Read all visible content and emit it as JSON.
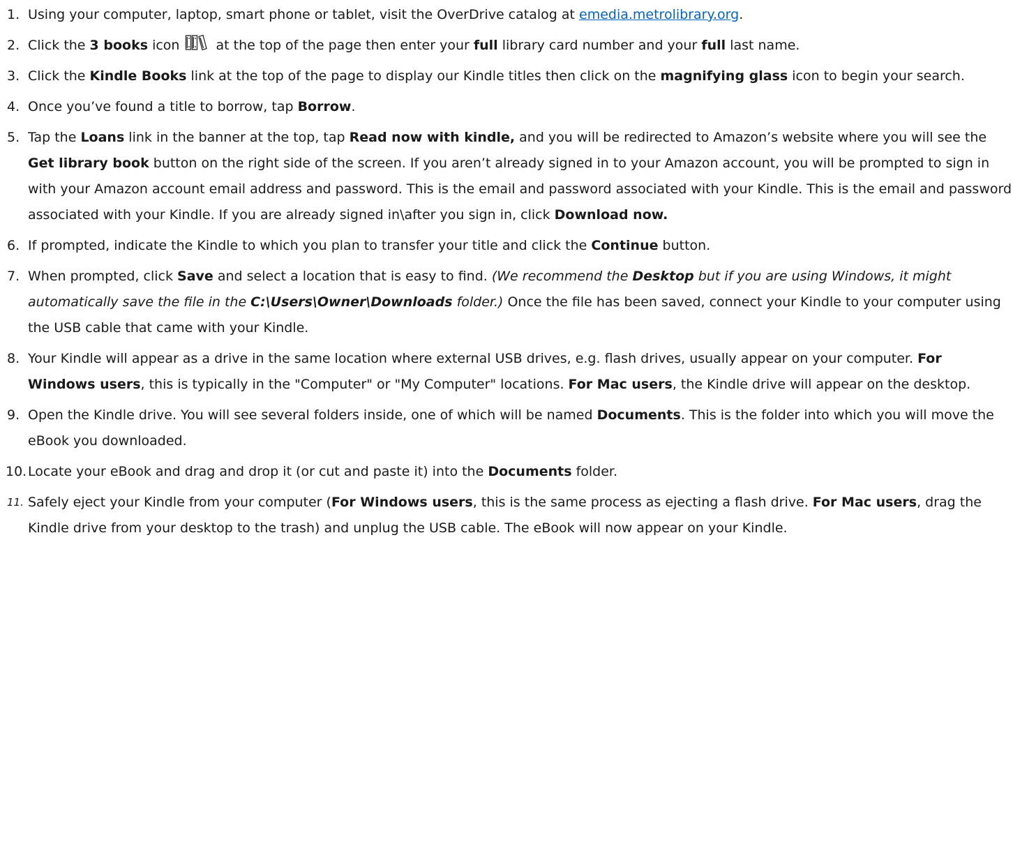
{
  "steps": [
    {
      "number": "1.",
      "p1": "Using your computer, laptop, smart phone or tablet, visit the OverDrive catalog at ",
      "link": "emedia.metrolibrary.org",
      "p2": "."
    },
    {
      "number": "2.",
      "p1": "Click the ",
      "b1": "3 books",
      "p2": " icon",
      "icon": "three-books-icon",
      "p3": " at the top of the page then enter your ",
      "b2": "full",
      "p4": " library card number and your ",
      "b3": "full",
      "p5": " last name."
    },
    {
      "number": "3.",
      "p1": "Click the ",
      "b1": "Kindle Books",
      "p2": " link at the top of the page to display our Kindle titles then click on the ",
      "b2": "magnifying glass",
      "p3": " icon to begin your search."
    },
    {
      "number": "4.",
      "p1": "Once you’ve found a title to borrow, tap ",
      "b1": "Borrow",
      "p2": "."
    },
    {
      "number": "5.",
      "p1": "Tap the ",
      "b1": "Loans",
      "p2": " link in the banner at the top, tap ",
      "b2": "Read now with kindle,",
      "p3": " and you will be redirected to Amazon’s website where you will see the ",
      "b3": "Get library book",
      "p4": " button on the right side of the screen. If you aren’t already signed in to your Amazon account, you will be prompted to sign in with your Amazon account email address and password. This is the email and password associated with your Kindle. This is the email and password associated with your Kindle. If you are already signed in\\after you sign in, click ",
      "b4": "Download now."
    },
    {
      "number": "6.",
      "p1": "If prompted, indicate the Kindle to which you plan to transfer your title and click the ",
      "b1": "Continue",
      "p2": " button."
    },
    {
      "number": "7.",
      "p1": "When prompted, click ",
      "b1": "Save",
      "p2": " and select a location that is easy to find. ",
      "i1": "(We recommend the ",
      "bi1": "Desktop",
      "i2": " but if you are using Windows, it might automatically save the file in the ",
      "bi2": "C:\\Users\\Owner\\Downloads",
      "i3": " folder.)",
      "p3": " Once the file has been saved, connect your Kindle to your computer using the USB cable that came with your Kindle."
    },
    {
      "number": "8.",
      "p1": "Your Kindle will appear as a drive in the same location where external USB drives, e.g. flash drives, usually appear on your computer. ",
      "b1": "For Windows users",
      "p2": ", this is typically in the \"Computer\" or \"My Computer\" locations. ",
      "b2": "For Mac users",
      "p3": ", the Kindle drive will appear on the desktop."
    },
    {
      "number": "9.",
      "p1": "Open the Kindle drive. You will see several folders inside, one of which will be named ",
      "b1": "Documents",
      "p2": ". This is the folder into which you will move the eBook you downloaded."
    },
    {
      "number": "10.",
      "p1": "Locate your eBook and drag and drop it (or cut and paste it) into the ",
      "b1": "Documents",
      "p2": " folder."
    },
    {
      "number": "11.",
      "p1": "Safely eject your Kindle from your computer (",
      "b1": "For Windows users",
      "p2": ", this is the same process as ejecting a flash drive. ",
      "b2": "For Mac users",
      "p3": ", drag the Kindle drive from your desktop to the trash) and unplug the USB cable. The eBook will now appear on your Kindle."
    }
  ]
}
